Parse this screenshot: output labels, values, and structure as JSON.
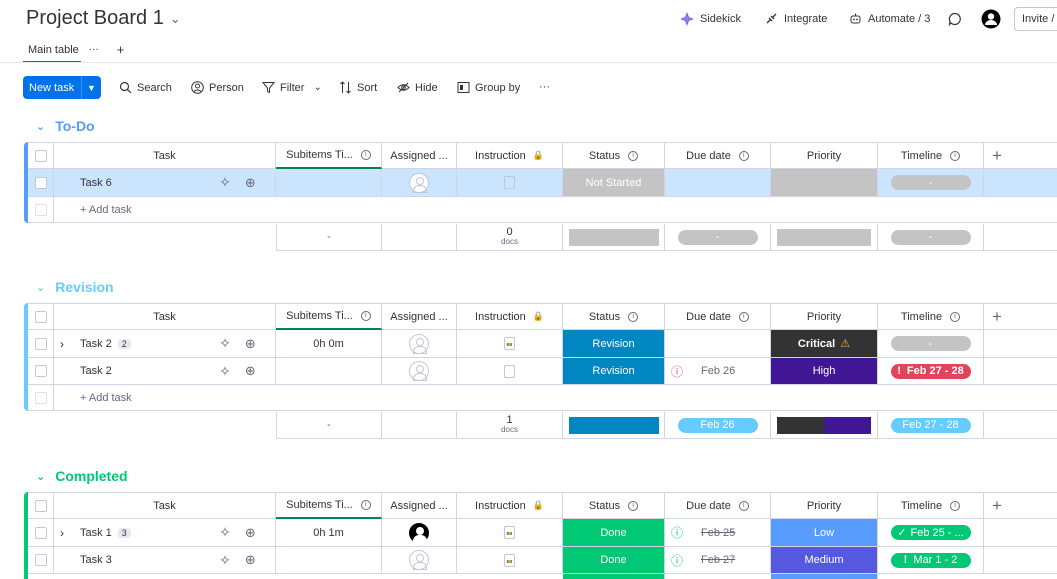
{
  "board": {
    "title": "Project Board 1"
  },
  "topbar": {
    "sidekick": "Sidekick",
    "integrate": "Integrate",
    "automate": "Automate / 3",
    "invite": "Invite /"
  },
  "tabs": {
    "main": "Main table",
    "more": "···",
    "add": "+"
  },
  "toolbar": {
    "new_task": "New task",
    "search": "Search",
    "person": "Person",
    "filter": "Filter",
    "sort": "Sort",
    "hide": "Hide",
    "group_by": "Group by",
    "more": "···"
  },
  "columns": {
    "task": "Task",
    "subitems": "Subitems Ti...",
    "assigned": "Assigned ...",
    "instruction": "Instruction",
    "status": "Status",
    "due": "Due date",
    "priority": "Priority",
    "timeline": "Timeline",
    "add": "+"
  },
  "add_task": "+ Add task",
  "colors": {
    "todo": "#579bfc",
    "revision": "#66ccff",
    "completed": "#00c875",
    "done": "#00c875",
    "stuck_blue": "#0073ea",
    "revision_status": "#0086c0",
    "critical": "#333333",
    "high": "#401694",
    "medium": "#5559df",
    "low": "#579bfc",
    "red": "#e2445c"
  },
  "groups": {
    "todo": {
      "name": "To-Do",
      "rows": [
        {
          "task": "Task 6",
          "subitems": "",
          "status": "Not Started",
          "due": "",
          "priority": "",
          "timeline": "-"
        }
      ],
      "summary": {
        "subitems": "-",
        "docs_count": "0",
        "docs_label": "docs",
        "due": "-",
        "timeline": "-"
      }
    },
    "revision": {
      "name": "Revision",
      "rows": [
        {
          "task": "Task 2",
          "subcount": "2",
          "subitems": "0h 0m",
          "status": "Revision",
          "due": "",
          "priority": "Critical",
          "priority_icon": "warning-icon",
          "timeline": "-"
        },
        {
          "task": "Task 2",
          "subitems": "",
          "status": "Revision",
          "due": "Feb 26",
          "priority": "High",
          "timeline": "Feb 27 - 28"
        }
      ],
      "summary": {
        "subitems": "-",
        "docs_count": "1",
        "docs_label": "docs",
        "due": "Feb 26",
        "timeline": "Feb 27 - 28"
      }
    },
    "completed": {
      "name": "Completed",
      "rows": [
        {
          "task": "Task 1",
          "subcount": "3",
          "subitems": "0h 1m",
          "status": "Done",
          "due": "Feb 25",
          "priority": "Low",
          "timeline": "Feb 25 - ..."
        },
        {
          "task": "Task 3",
          "subitems": "",
          "status": "Done",
          "due": "Feb 27",
          "priority": "Medium",
          "timeline": "Mar 1 - 2"
        }
      ]
    }
  }
}
